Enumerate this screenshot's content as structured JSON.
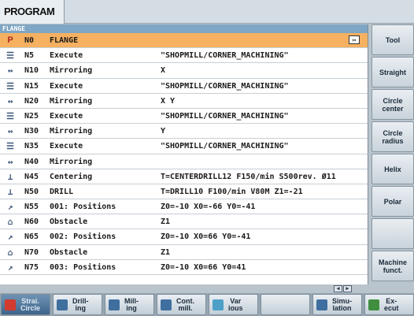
{
  "header": {
    "title": "PROGRAM"
  },
  "program": {
    "title": "FLANGE",
    "end_marker": "↦",
    "rows": [
      {
        "icon": "P",
        "icon_name": "program-header-icon",
        "nr": "N0",
        "name": "FLANGE",
        "params": "",
        "selected": true
      },
      {
        "icon": "☰",
        "icon_name": "subroutine-icon",
        "nr": "N5",
        "name": "Execute",
        "params": "\"SHOPMILL/CORNER_MACHINING\""
      },
      {
        "icon": "↔",
        "icon_name": "mirror-icon",
        "nr": "N10",
        "name": "Mirroring",
        "params": "X"
      },
      {
        "icon": "☰",
        "icon_name": "subroutine-icon",
        "nr": "N15",
        "name": "Execute",
        "params": "\"SHOPMILL/CORNER_MACHINING\""
      },
      {
        "icon": "↔",
        "icon_name": "mirror-icon",
        "nr": "N20",
        "name": "Mirroring",
        "params": "X Y"
      },
      {
        "icon": "☰",
        "icon_name": "subroutine-icon",
        "nr": "N25",
        "name": "Execute",
        "params": "\"SHOPMILL/CORNER_MACHINING\""
      },
      {
        "icon": "↔",
        "icon_name": "mirror-icon",
        "nr": "N30",
        "name": "Mirroring",
        "params": "Y"
      },
      {
        "icon": "☰",
        "icon_name": "subroutine-icon",
        "nr": "N35",
        "name": "Execute",
        "params": "\"SHOPMILL/CORNER_MACHINING\""
      },
      {
        "icon": "↔",
        "icon_name": "mirror-icon",
        "nr": "N40",
        "name": "Mirroring",
        "params": ""
      },
      {
        "icon": "⊥",
        "icon_name": "centering-icon",
        "nr": "N45",
        "name": "Centering",
        "params": "T=CENTERDRILL12 F150/min S500rev. Ø11"
      },
      {
        "icon": "⊥",
        "icon_name": "drill-icon",
        "nr": "N50",
        "name": "DRILL",
        "params": "T=DRILL10 F100/min V80M Z1=-21"
      },
      {
        "icon": "↗",
        "icon_name": "positions-icon",
        "nr": "N55",
        "name": "001: Positions",
        "params": "Z0=-10 X0=-66 Y0=-41"
      },
      {
        "icon": "⌂",
        "icon_name": "obstacle-icon",
        "nr": "N60",
        "name": "Obstacle",
        "params": "Z1"
      },
      {
        "icon": "↗",
        "icon_name": "positions-icon",
        "nr": "N65",
        "name": "002: Positions",
        "params": "Z0=-10 X0=66 Y0=-41"
      },
      {
        "icon": "⌂",
        "icon_name": "obstacle-icon",
        "nr": "N70",
        "name": "Obstacle",
        "params": "Z1"
      },
      {
        "icon": "↗",
        "icon_name": "positions-icon",
        "nr": "N75",
        "name": "003: Positions",
        "params": "Z0=-10 X0=66 Y0=41"
      }
    ]
  },
  "scroll_hint": {
    "left": "◀",
    "right": "▶"
  },
  "right_softkeys": [
    {
      "label": "Tool"
    },
    {
      "label": "Straight"
    },
    {
      "label": "Circle\ncenter"
    },
    {
      "label": "Circle\nradius"
    },
    {
      "label": "Helix"
    },
    {
      "label": "Polar"
    },
    {
      "label": ""
    },
    {
      "label": "Machine\nfunct."
    }
  ],
  "bottom_softkeys": [
    {
      "label": "Strai.\nCircle",
      "active": true,
      "icon_color": "#d23b2f"
    },
    {
      "label": "Drill-\ning",
      "icon_color": "#3f6f9f"
    },
    {
      "label": "Mill-\ning",
      "icon_color": "#3f6f9f"
    },
    {
      "label": "Cont.\nmill.",
      "icon_color": "#3f6f9f"
    },
    {
      "label": "Var\nious",
      "icon_color": "#4fa0c8"
    },
    {
      "label": ""
    },
    {
      "label": "Simu-\nlation",
      "icon_color": "#3f6f9f"
    },
    {
      "label": "Ex-\necut",
      "icon_color": "#3f8f3f"
    }
  ]
}
